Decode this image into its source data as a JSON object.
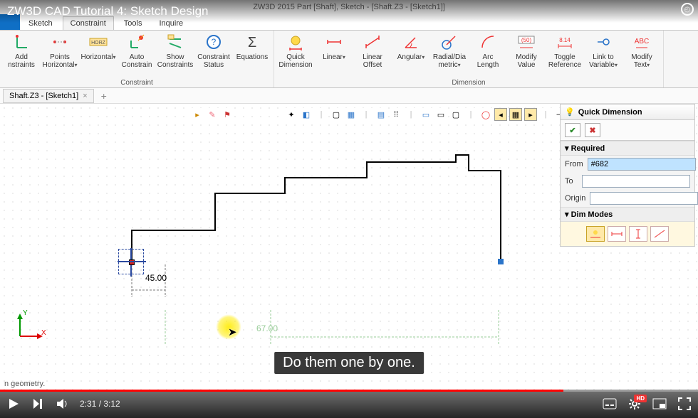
{
  "video_title": "ZW3D CAD Tutorial 4: Sketch Design",
  "app_window_title": "ZW3D 2015      Part [Shaft],  Sketch - [Shaft.Z3 - [Sketch1]]",
  "tabs": {
    "file": "",
    "t1": "Sketch",
    "t2": "Constraint",
    "t3": "Tools",
    "t4": "Inquire"
  },
  "ribbon": {
    "constraint": {
      "label": "Constraint",
      "add_constraints": "Add\nnstraints",
      "points_horizontal": "Points\nHorizontal",
      "horizontal": "Horizontal",
      "auto_constrain": "Auto\nConstrain",
      "show_constraints": "Show\nConstraints",
      "constraint_status": "Constraint\nStatus",
      "equations": "Equations"
    },
    "dimension": {
      "label": "Dimension",
      "quick_dimension": "Quick\nDimension",
      "linear": "Linear",
      "linear_offset": "Linear\nOffset",
      "angular": "Angular",
      "radial_dia": "Radial/Dia\nmetric",
      "arc_length": "Arc\nLength",
      "modify_value": "Modify\nValue",
      "toggle_reference": "Toggle\nReference",
      "link_to_variable": "Link to\nVariable",
      "modify_text": "Modify\nText"
    }
  },
  "doc_tab": {
    "label": "Shaft.Z3 - [Sketch1]",
    "close": "×",
    "new": "+"
  },
  "canvas": {
    "dim_value": "45.00",
    "ghost_dim": "67.00",
    "axis_x": "X",
    "axis_y": "Y"
  },
  "panel": {
    "title": "Quick Dimension",
    "required": "Required",
    "from_label": "From",
    "from_value": "#682",
    "to_label": "To",
    "to_value": "",
    "origin_label": "Origin",
    "origin_value": "",
    "dim_modes": "Dim Modes"
  },
  "caption": "Do them one by one.",
  "status_hint": "n geometry.",
  "player": {
    "current": "2:31",
    "total": "3:12",
    "separator": " / "
  }
}
